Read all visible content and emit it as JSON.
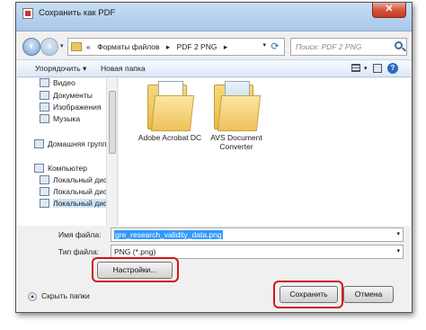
{
  "window": {
    "title": "Сохранить как PDF",
    "close_glyph": "✕"
  },
  "address": {
    "crumbs": [
      "«",
      "Форматы файлов",
      "▸",
      "PDF 2 PNG",
      "▸"
    ],
    "search_placeholder": "Поиск: PDF 2 PNG"
  },
  "toolbar": {
    "organize": "Упорядочить ▾",
    "new_folder": "Новая папка",
    "help": "?"
  },
  "nav": {
    "items": [
      "Видео",
      "Документы",
      "Изображения",
      "Музыка",
      "Домашняя группа",
      "Компьютер",
      "Локальный диск",
      "Локальный диск",
      "Локальный диск"
    ]
  },
  "files": [
    {
      "name": "Adobe Acrobat DC"
    },
    {
      "name": "AVS Document Converter"
    }
  ],
  "form": {
    "filename_label": "Имя файла:",
    "filename_value": "gre_research_validity_data.png",
    "filetype_label": "Тип файла:",
    "filetype_value": "PNG (*.png)",
    "settings_button": "Настройки..."
  },
  "footer": {
    "hide_folders": "Скрыть папки",
    "save_button": "Сохранить",
    "cancel_button": "Отмена"
  },
  "colors": {
    "highlight": "#d0161b",
    "selection": "#3399ff"
  }
}
